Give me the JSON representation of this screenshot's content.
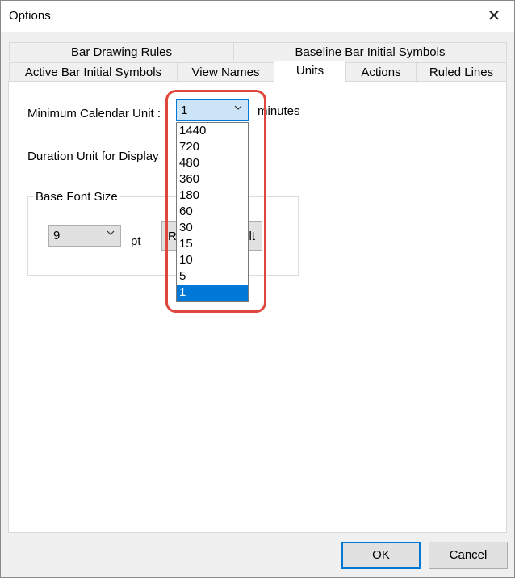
{
  "window": {
    "title": "Options",
    "close_glyph": "✕"
  },
  "tabs": {
    "row1": [
      {
        "label": "Bar Drawing Rules"
      },
      {
        "label": "Baseline Bar Initial Symbols"
      }
    ],
    "row2": [
      {
        "label": "Active Bar Initial Symbols"
      },
      {
        "label": "View Names"
      },
      {
        "label": "Units",
        "active": true
      },
      {
        "label": "Actions"
      },
      {
        "label": "Ruled Lines"
      }
    ]
  },
  "units": {
    "min_calendar_label": "Minimum Calendar Unit :",
    "min_calendar_value": "1",
    "min_calendar_suffix": "minutes",
    "duration_label": "Duration Unit for Display",
    "dropdown_options": [
      "1440",
      "720",
      "480",
      "360",
      "180",
      "60",
      "30",
      "15",
      "10",
      "5",
      "1"
    ],
    "dropdown_selected": "1",
    "base_font_group": "Base Font Size",
    "font_size_value": "9",
    "font_size_unit": "pt",
    "reset_button_left": "R",
    "reset_button_right": "lt"
  },
  "footer": {
    "ok_label": "OK",
    "cancel_label": "Cancel"
  },
  "colors": {
    "accent": "#0078d7",
    "annotation": "#e0463a"
  }
}
